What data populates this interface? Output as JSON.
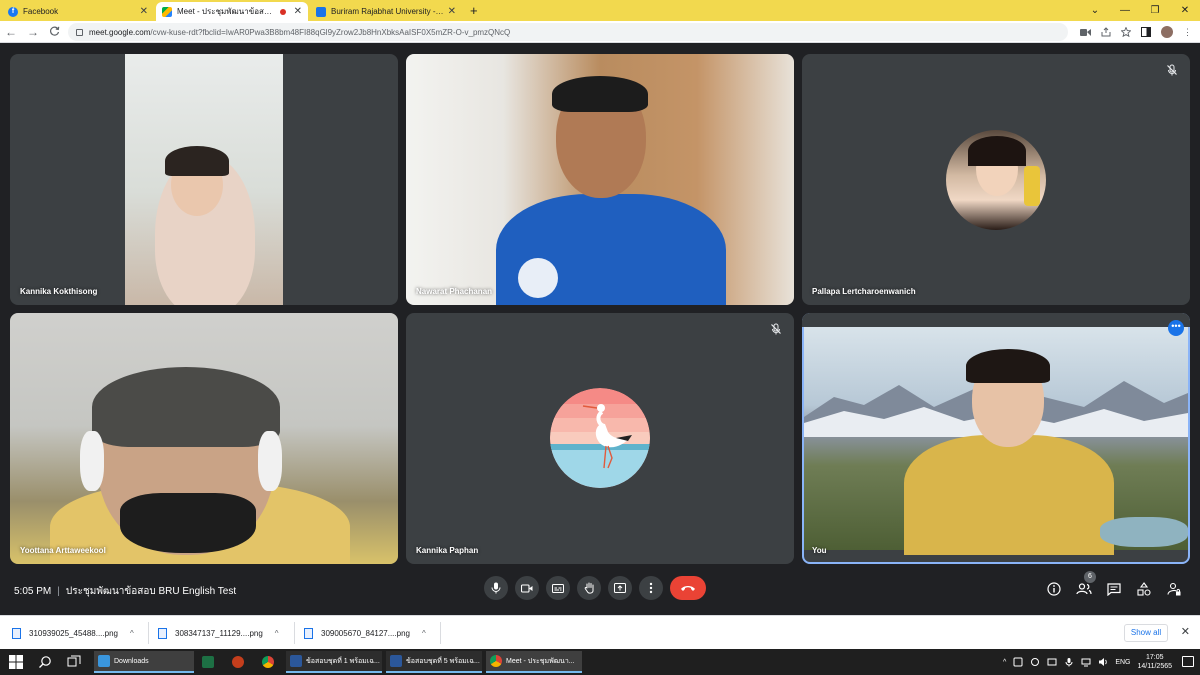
{
  "browser": {
    "tabs": [
      {
        "title": "Facebook",
        "favicon": "facebook-icon",
        "active": false
      },
      {
        "title": "Meet - ประชุมพัฒนาข้อสอบ BRU",
        "favicon": "google-meet-icon",
        "active": true
      },
      {
        "title": "Buriram Rajabhat University - Co",
        "favicon": "site-icon",
        "active": false
      }
    ],
    "close_glyph": "✕",
    "new_tab_glyph": "+",
    "window_controls": [
      "⌄",
      "—",
      "❐",
      "✕"
    ],
    "url": {
      "host": "meet.google.com",
      "path": "/cvw-kuse-rdt?fbclid=IwAR0Pwa3B8bm48FI88qGl9yZrow2Jb8HnXbksAaISF0X5mZR-O-v_pmzQNcQ"
    },
    "nav": {
      "back": "←",
      "forward": "→",
      "reload": "C"
    }
  },
  "meet": {
    "participants": [
      {
        "name": "Kannika Kokthisong",
        "muted": false
      },
      {
        "name": "Nawarat Phachanan",
        "muted": false
      },
      {
        "name": "Pallapa Lertcharoenwanich",
        "muted": true
      },
      {
        "name": "Yoottana Arttaweekool",
        "muted": false
      },
      {
        "name": "Kannika Paphan",
        "muted": true
      },
      {
        "name": "You",
        "muted": false,
        "speaking": true
      }
    ],
    "more_options_glyph": "•••",
    "time": "5:05 PM",
    "separator": "|",
    "meeting_title": "ประชุมพัฒนาข้อสอบ BRU English Test",
    "participant_count": "6",
    "colors": {
      "end_call": "#ea4335",
      "speaking_outline": "#8ab4f8",
      "tile_bg": "#3c4043"
    }
  },
  "downloads": {
    "items": [
      {
        "filename": "310939025_45488....png"
      },
      {
        "filename": "308347137_11129....png"
      },
      {
        "filename": "309005670_84127....png"
      }
    ],
    "caret": "^",
    "show_all": "Show all",
    "close_glyph": "✕"
  },
  "taskbar": {
    "apps": [
      {
        "label": "Downloads",
        "icon": "folder-download-icon"
      },
      {
        "label": "",
        "icon": "excel-icon"
      },
      {
        "label": "",
        "icon": "powerpoint-icon"
      },
      {
        "label": "",
        "icon": "chrome-icon"
      },
      {
        "label": "ข้อสอบชุดที่ 1 พร้อมเฉ...",
        "icon": "word-icon"
      },
      {
        "label": "ข้อสอบชุดที่ 5 พร้อมเฉ...",
        "icon": "word-icon"
      },
      {
        "label": "Meet - ประชุมพัฒนา...",
        "icon": "chrome-icon"
      }
    ],
    "tray": {
      "language": "ENG",
      "time": "17:05",
      "date": "14/11/2565",
      "chevron": "^"
    }
  }
}
